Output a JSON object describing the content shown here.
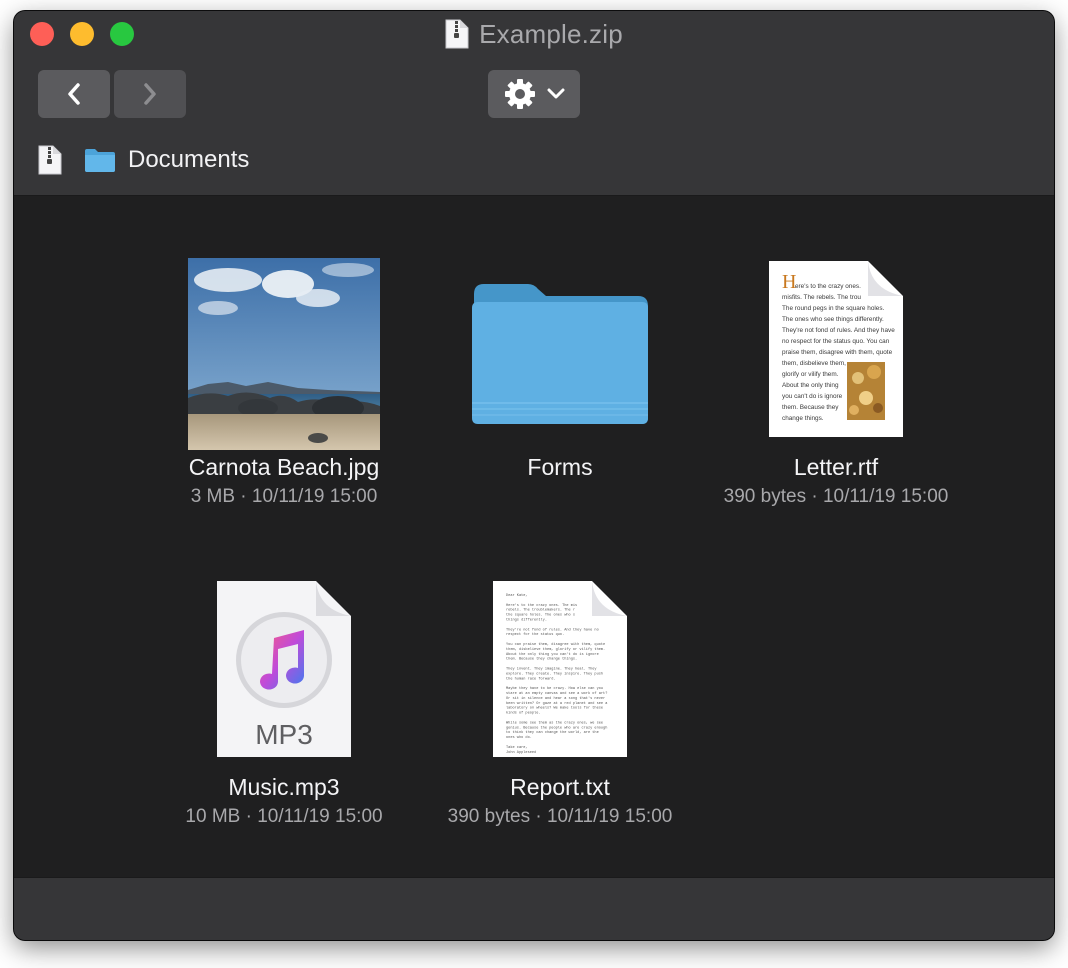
{
  "window": {
    "title": "Example.zip"
  },
  "toolbar": {
    "back_icon": "chevron-left-icon",
    "forward_icon": "chevron-right-icon",
    "action_icon": "gear-icon"
  },
  "pathbar": {
    "items": [
      {
        "icon": "zip-archive-icon"
      },
      {
        "icon": "folder-icon",
        "label": "Documents"
      }
    ]
  },
  "items": [
    {
      "name": "Carnota Beach.jpg",
      "meta": "3 MB · 10/11/19 15:00",
      "icon": "image-thumbnail"
    },
    {
      "name": "Forms",
      "meta": "",
      "icon": "folder-icon"
    },
    {
      "name": "Letter.rtf",
      "meta": "390 bytes · 10/11/19 15:00",
      "icon": "rtf-document-icon",
      "preview_lines": [
        "ere's to the crazy ones.",
        "misfits. The rebels. The trou",
        "The round pegs in the square holes.",
        "The ones who see things differently.",
        "They're not fond of rules. And they have",
        "no respect for the status quo. You can",
        "praise them, disagree with them, quote",
        "them, disbelieve them,",
        "glorify or vilify them.",
        "About the only thing",
        "you can't do is ignore",
        "them. Because they",
        "change things."
      ]
    },
    {
      "name": "Music.mp3",
      "meta": "10 MB · 10/11/19 15:00",
      "icon": "music-note-icon",
      "badge": "MP3"
    },
    {
      "name": "Report.txt",
      "meta": "390 bytes · 10/11/19 15:00",
      "icon": "text-document-icon",
      "preview_lines": [
        "Dear Kate,",
        "",
        "Here's to the crazy ones. The mis",
        "rebels. The troublemakers. The r",
        "the square holes. The ones who s",
        "things differently.",
        "",
        "They're not fond of rules. And they have no",
        "respect for the status quo.",
        "",
        "You can praise them, disagree with them, quote",
        "them, disbelieve them, glorify or vilify them.",
        "About the only thing you can't do is ignore",
        "them. Because they change things.",
        "",
        "They invent. They imagine. They heal. They",
        "explore. They create. They inspire. They push",
        "the human race forward.",
        "",
        "Maybe they have to be crazy. How else can you",
        "stare at an empty canvas and see a work of art?",
        "Or sit in silence and hear a song that's never",
        "been written? Or gaze at a red planet and see a",
        "laboratory on wheels? We make tools for these",
        "kinds of people.",
        "",
        "While some see them as the crazy ones, we see",
        "genius. Because the people who are crazy enough",
        "to think they can change the world, are the",
        "ones who do.",
        "",
        "Take care,",
        "John Appleseed"
      ]
    }
  ]
}
